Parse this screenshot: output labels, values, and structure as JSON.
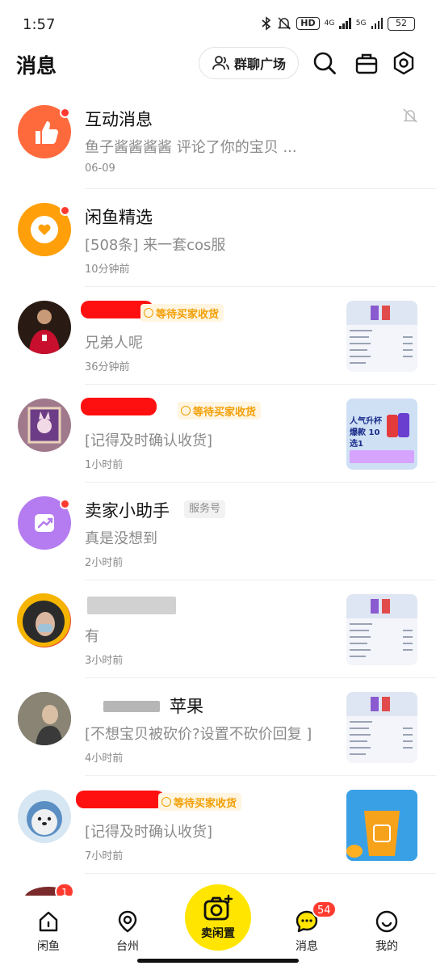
{
  "status_bar": {
    "time": "1:57",
    "hd_label": "HD",
    "net1": "4G",
    "net2": "5G",
    "battery": "52"
  },
  "header": {
    "title": "消息",
    "group_plaza_label": "群聊广场"
  },
  "conversations": [
    {
      "name": "互动消息",
      "message": "鱼子酱酱酱酱 评论了你的宝贝 ...",
      "time": "06-09",
      "avatar": "thumbs-up-icon",
      "unread_dot": true,
      "muted": true
    },
    {
      "name": "闲鱼精选",
      "message": "[508条] 来一套cos服",
      "time": "10分钟前",
      "avatar": "heart-icon",
      "unread_dot": true
    },
    {
      "name": "",
      "tag": "等待买家收货",
      "message": "兄弟人呢",
      "time": "36分钟前",
      "avatar": "user-photo",
      "thumbnail": "menu-list"
    },
    {
      "name": "",
      "tag": "等待买家收货",
      "message": "[记得及时确认收货]",
      "time": "1小时前",
      "avatar": "user-photo",
      "thumbnail": "promo",
      "thumbnail_text": "人气升杯爆款 10选1"
    },
    {
      "name": "卖家小助手",
      "service_tag": "服务号",
      "message": "真是没想到",
      "time": "2小时前",
      "avatar": "trend-icon",
      "unread_dot": true
    },
    {
      "name": "",
      "message": "有",
      "time": "3小时前",
      "avatar": "user-photo",
      "thumbnail": "menu-list"
    },
    {
      "name": "苹果",
      "message": "[不想宝贝被砍价?设置不砍价回复 ]",
      "time": "4小时前",
      "avatar": "user-photo",
      "thumbnail": "menu-list"
    },
    {
      "name": "",
      "tag": "等待买家收货",
      "message": "[记得及时确认收货]",
      "time": "7小时前",
      "avatar": "user-photo",
      "thumbnail": "drink"
    }
  ],
  "bottom_nav": {
    "items": [
      {
        "label": "闲鱼",
        "icon": "home-icon"
      },
      {
        "label": "台州",
        "icon": "location-icon"
      },
      {
        "label": "卖闲置",
        "icon": "camera-icon"
      },
      {
        "label": "消息",
        "icon": "chat-icon",
        "badge": "54"
      },
      {
        "label": "我的",
        "icon": "smile-icon"
      }
    ]
  },
  "peek_badge": "1",
  "colors": {
    "accent_yellow": "#ffe500",
    "tag_orange": "#f29f05",
    "unread_red": "#ff3b30",
    "interactive_orange": "#ff6a3d",
    "selection_orange": "#ff9f0a",
    "assistant_purple": "#b57bf0"
  }
}
